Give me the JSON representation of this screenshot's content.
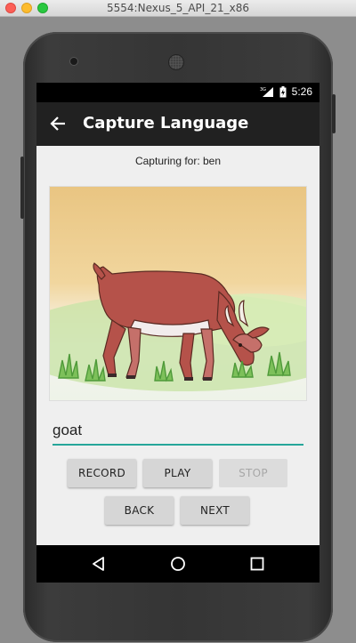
{
  "window": {
    "title": "5554:Nexus_5_API_21_x86"
  },
  "status_bar": {
    "signal_label": "3G",
    "time": "5:26"
  },
  "app_bar": {
    "title": "Capture Language"
  },
  "content": {
    "capturing_text": "Capturing for: ben",
    "word_value": "goat",
    "image_subject": "goat-illustration"
  },
  "buttons": {
    "record": "RECORD",
    "play": "PLAY",
    "stop": "STOP",
    "back": "BACK",
    "next": "NEXT"
  },
  "colors": {
    "accent": "#26a69a",
    "app_bar": "#212121",
    "button": "#d6d6d6"
  }
}
